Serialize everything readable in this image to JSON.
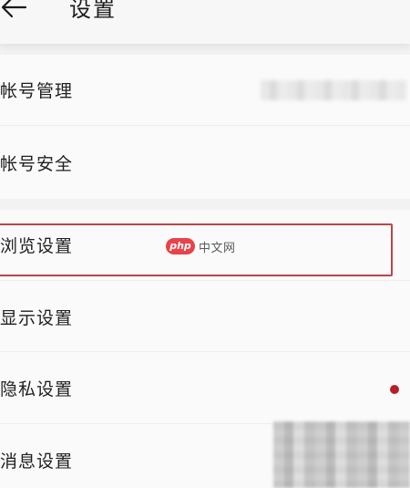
{
  "header": {
    "title": "设置",
    "back_icon": "arrow-left-icon"
  },
  "account_group": {
    "items": [
      {
        "label": "帐号管理"
      },
      {
        "label": "帐号安全"
      }
    ]
  },
  "settings_group": {
    "items": [
      {
        "label": "浏览设置"
      },
      {
        "label": "显示设置"
      },
      {
        "label": "隐私设置"
      },
      {
        "label": "消息设置"
      }
    ]
  },
  "watermark": {
    "logo": "php",
    "text": "中文网"
  },
  "colors": {
    "highlight_border": "#b8464b",
    "notification_dot": "#b4202a",
    "watermark_logo": "#e9424a"
  }
}
